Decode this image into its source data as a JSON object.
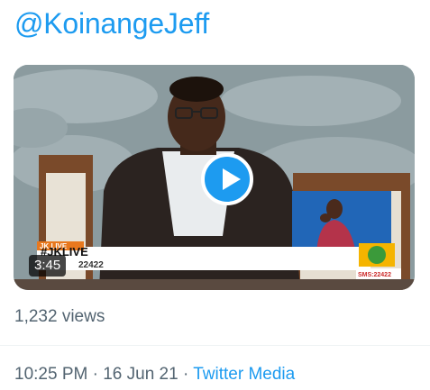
{
  "handle": "@KoinangeJeff",
  "video": {
    "duration": "3:45",
    "overlay": {
      "show_tag": "JK LIVE",
      "hashtag": "#JKLIVE",
      "sms_partial": "22422",
      "channel_sms": "SMS:22422"
    }
  },
  "views": "1,232 views",
  "meta": {
    "time": "10:25 PM",
    "separator": " · ",
    "date": "16 Jun 21",
    "source": "Twitter Media"
  },
  "colors": {
    "accent": "#1d9bf0",
    "secondary_text": "#536471",
    "divider": "#eff3f4"
  }
}
